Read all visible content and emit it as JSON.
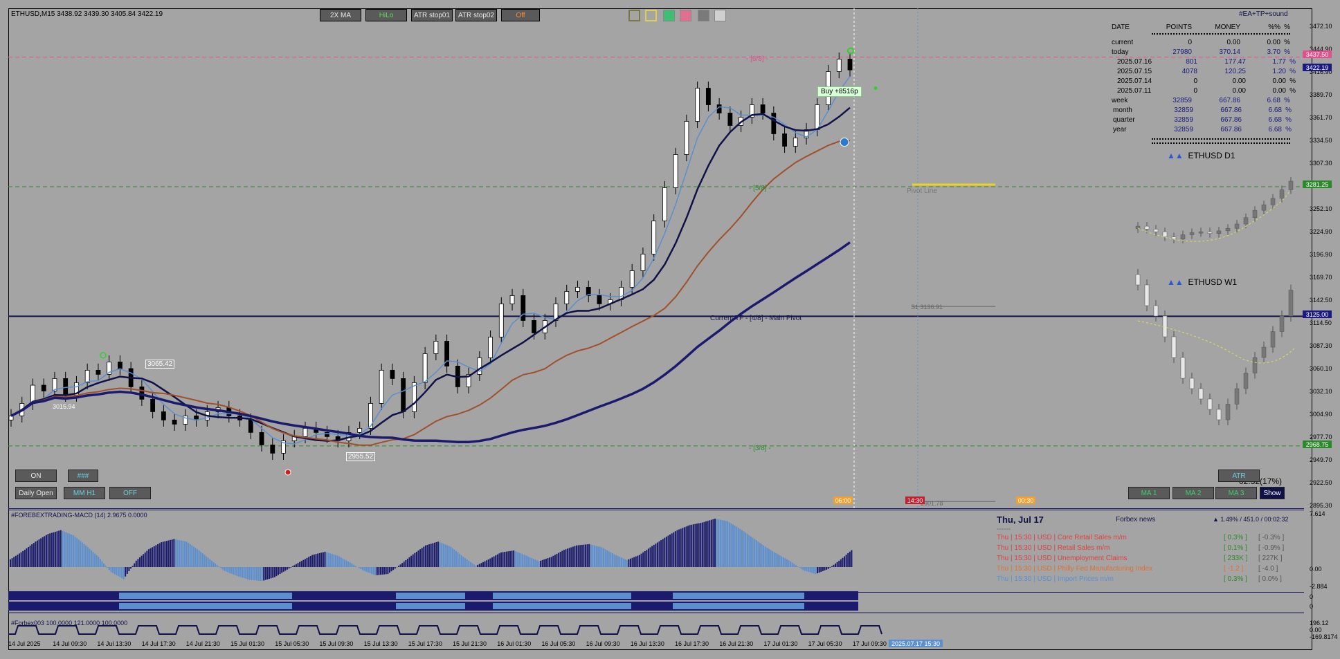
{
  "header": {
    "symbol_info": "ETHUSD,M15  3438.92 3439.30 3405.84 3422.19",
    "ea_label": "#EA+TP+sound"
  },
  "toolbar": {
    "buttons": [
      {
        "label": "2X MA",
        "color": "#e8e8e8"
      },
      {
        "label": "HiLo",
        "color": "#5fe05f"
      },
      {
        "label": "ATR stop01",
        "color": "#e8e8e8"
      },
      {
        "label": "ATR stop02",
        "color": "#e8e8e8"
      },
      {
        "label": "Off",
        "color": "#ff8c3a"
      }
    ],
    "color_swatches": [
      "#a4a4a4",
      "#e0d050",
      "#3fbf6f",
      "#e07090",
      "#7a7a7a",
      "#d0d0d0"
    ]
  },
  "profit_table": {
    "headers": [
      "DATE",
      "POINTS",
      "MONEY",
      "%%",
      "%"
    ],
    "rows": [
      {
        "date": "current",
        "points": "0",
        "money": "0.00",
        "pct": "0.00",
        "unit": "%",
        "color": "#000000"
      },
      {
        "date": "today",
        "points": "27980",
        "money": "370.14",
        "pct": "3.70",
        "unit": "%",
        "color": "#1a1a80"
      },
      {
        "date": "2025.07.16",
        "points": "801",
        "money": "177.47",
        "pct": "1.77",
        "unit": "%",
        "color": "#1a1a80"
      },
      {
        "date": "2025.07.15",
        "points": "4078",
        "money": "120.25",
        "pct": "1.20",
        "unit": "%",
        "color": "#1a1a80"
      },
      {
        "date": "2025.07.14",
        "points": "0",
        "money": "0.00",
        "pct": "0.00",
        "unit": "%",
        "color": "#000000"
      },
      {
        "date": "2025.07.11",
        "points": "0",
        "money": "0.00",
        "pct": "0.00",
        "unit": "%",
        "color": "#000000"
      },
      {
        "date": "week",
        "points": "32859",
        "money": "667.86",
        "pct": "6.68",
        "unit": "%",
        "color": "#1a1a80"
      },
      {
        "date": "month",
        "points": "32859",
        "money": "667.86",
        "pct": "6.68",
        "unit": "%",
        "color": "#1a1a80"
      },
      {
        "date": "quarter",
        "points": "32859",
        "money": "667.86",
        "pct": "6.68",
        "unit": "%",
        "color": "#1a1a80"
      },
      {
        "date": "year",
        "points": "32859",
        "money": "667.86",
        "pct": "6.68",
        "unit": "%",
        "color": "#1a1a80"
      }
    ]
  },
  "mini_charts": {
    "d1_label": "ETHUSD  D1",
    "w1_label": "ETHUSD  W1"
  },
  "chart_labels": {
    "level_68": "- [6/8] -",
    "level_58": "- [5/8] -",
    "level_48": "Current TF - [4/8] - Main Pivot",
    "level_38": "- [3/8] -",
    "pivot_line": "Pivot Line",
    "buy_label": "Buy +8516p",
    "price_3065": "3065.42",
    "price_2955": "2955.52",
    "mini_price": "3015.94",
    "pivot_price": "S1 3136.91",
    "fib_price": "2901.78",
    "time_tag1": "06:00",
    "time_tag2": "14:30",
    "time_tag3": "00:30",
    "countdown": "02:32(17%)"
  },
  "left_buttons": {
    "on": "ON",
    "hash": "###",
    "daily_open": "Daily Open",
    "mm_h1": "MM H1",
    "off": "OFF"
  },
  "right_buttons": {
    "atr": "ATR",
    "ma1": "MA 1",
    "ma2": "MA 2",
    "ma3": "MA 3",
    "show": "Show"
  },
  "price_axis": {
    "ticks": [
      "3472.10",
      "3444.90",
      "3416.90",
      "3389.70",
      "3361.70",
      "3334.50",
      "3307.30",
      "3279.30",
      "3252.10",
      "3224.90",
      "3196.90",
      "3169.70",
      "3142.50",
      "3114.50",
      "3087.30",
      "3060.10",
      "3032.10",
      "3004.90",
      "2977.70",
      "2949.70",
      "2922.50",
      "2895.30"
    ],
    "tags": [
      {
        "label": "3437.50",
        "color": "#e0508a"
      },
      {
        "label": "3422.19",
        "color": "#1a1a80"
      },
      {
        "label": "3281.25",
        "color": "#2a8a2a"
      },
      {
        "label": "3125.00",
        "color": "#1a1a80"
      },
      {
        "label": "2968.75",
        "color": "#2a8a2a"
      }
    ]
  },
  "macd": {
    "label": "#FOREBEXTRADING-MACD (14) 2.9675 0.0000",
    "ticks": [
      "7.614",
      "0.00",
      "-2.884"
    ],
    "bar_values": [
      1.2,
      2.5,
      4.0,
      5.2,
      5.8,
      5.0,
      3.4,
      1.6,
      -0.8,
      -1.9,
      1.0,
      2.8,
      3.9,
      4.4,
      4.0,
      2.6,
      1.0,
      -0.6,
      -1.4,
      -2.0,
      -2.2,
      -1.6,
      -0.4,
      0.8,
      1.9,
      2.4,
      1.8,
      0.7,
      -0.5,
      -1.3,
      -1.1,
      0.4,
      2.0,
      3.4,
      4.0,
      3.2,
      1.6,
      0.2,
      1.2,
      2.3,
      2.6,
      1.8,
      0.9,
      1.6,
      2.7,
      3.4,
      3.6,
      3.1,
      2.0,
      1.1,
      1.9,
      3.3,
      4.6,
      5.8,
      6.6,
      7.0,
      7.6,
      7.2,
      6.0,
      4.6,
      3.2,
      2.0,
      0.9,
      -0.5,
      -1.1,
      -0.3,
      1.2,
      2.9
    ],
    "colors": [
      "#1a1a6e",
      "#5b8fd0"
    ]
  },
  "subpanes": {
    "pane2_ticks": [
      "0",
      "0"
    ],
    "pane3_label": "#Forbex003  100.0000 121.0000 100.0000",
    "pane3_ticks": [
      "196.12",
      "0.00",
      "-169.8174"
    ]
  },
  "news": {
    "date": "Thu, Jul 17",
    "title": "Forbex news",
    "meta": "▲ 1.49% / 451.0 / 00:02:32",
    "dashes": "------",
    "items": [
      {
        "text": "Thu  |  15:30  |  USD  |  Core Retail Sales m/m",
        "actual": "[ 0.3% ]",
        "prev": "[ -0.3% ]",
        "color": "#e04040",
        "color2": "#2a8a2a"
      },
      {
        "text": "Thu  |  15:30  |  USD  |  Retail Sales m/m",
        "actual": "[ 0.1% ]",
        "prev": "[ -0.9% ]",
        "color": "#e04040",
        "color2": "#2a8a2a"
      },
      {
        "text": "Thu  |  15:30  |  USD  |  Unemployment Claims",
        "actual": "[ 233K ]",
        "prev": "[ 227K ]",
        "color": "#e04040",
        "color2": "#2a8a2a"
      },
      {
        "text": "Thu  |  15:30  |  USD  |  Philly Fed Manufacturing Index",
        "actual": "[ -1.2 ]",
        "prev": "[ -4.0 ]",
        "color": "#e07030",
        "color2": "#e07030"
      },
      {
        "text": "Thu  |  15:30  |  USD  |  Import Prices m/m",
        "actual": "[ 0.3% ]",
        "prev": "[ 0.0% ]",
        "color": "#5b8fd0",
        "color2": "#2a8a2a"
      }
    ]
  },
  "time_axis": {
    "ticks": [
      "14 Jul 2025",
      "14 Jul 09:30",
      "14 Jul 13:30",
      "14 Jul 17:30",
      "14 Jul 21:30",
      "15 Jul 01:30",
      "15 Jul 05:30",
      "15 Jul 09:30",
      "15 Jul 13:30",
      "15 Jul 17:30",
      "15 Jul 21:30",
      "16 Jul 01:30",
      "16 Jul 05:30",
      "16 Jul 09:30",
      "16 Jul 13:30",
      "16 Jul 17:30",
      "16 Jul 21:30",
      "17 Jul 01:30",
      "17 Jul 05:30",
      "17 Jul 09:30"
    ],
    "cursor_date": "2025.07.17 15:30"
  },
  "chart_data": {
    "type": "candlestick",
    "title": "ETHUSD,M15",
    "ylim": [
      2895.3,
      3472.1
    ],
    "closes": [
      3005,
      3020,
      3042,
      3035,
      3050,
      3030,
      3045,
      3060,
      3055,
      3070,
      3062,
      3040,
      3025,
      3010,
      3000,
      2995,
      3005,
      3000,
      3010,
      3015,
      3005,
      3000,
      2985,
      2970,
      2960,
      2975,
      2980,
      2990,
      2985,
      2980,
      2975,
      2985,
      2990,
      3020,
      3060,
      3050,
      3010,
      3045,
      3080,
      3095,
      3065,
      3040,
      3055,
      3075,
      3100,
      3140,
      3150,
      3120,
      3105,
      3120,
      3140,
      3155,
      3160,
      3150,
      3140,
      3145,
      3160,
      3180,
      3200,
      3240,
      3280,
      3320,
      3360,
      3400,
      3380,
      3370,
      3355,
      3365,
      3380,
      3370,
      3345,
      3330,
      3340,
      3350,
      3380,
      3420,
      3435,
      3422
    ]
  }
}
